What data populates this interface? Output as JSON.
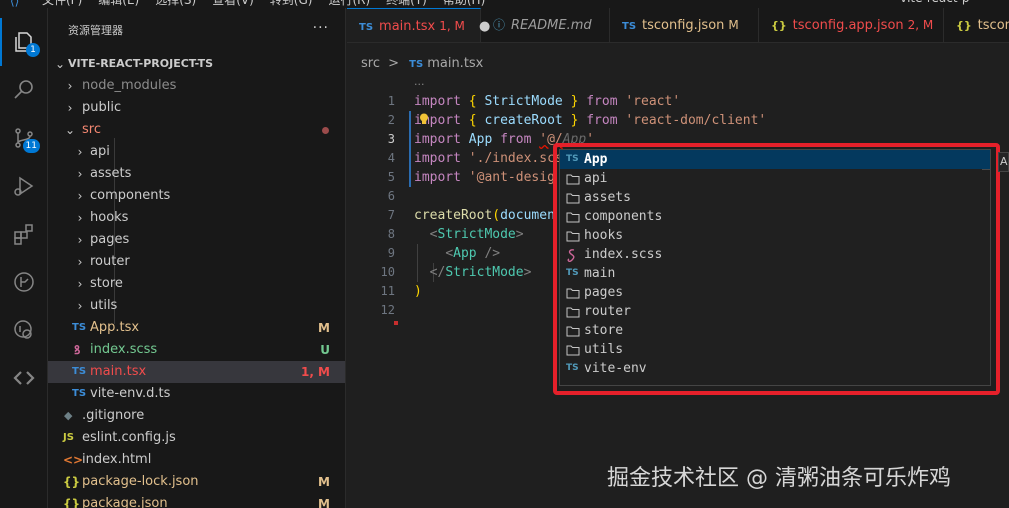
{
  "menubar": {
    "items": [
      "文件(F)",
      "编辑(E)",
      "选择(S)",
      "查看(V)",
      "转到(G)",
      "运行(R)",
      "终端(T)",
      "帮助(H)"
    ],
    "command_center": "vite-react-p"
  },
  "activity_bar": {
    "explorer_badge": "1",
    "scm_badge": "11"
  },
  "sidebar": {
    "title": "资源管理器",
    "more": "···",
    "project": "VITE-REACT-PROJECT-TS",
    "items": {
      "node_modules": "node_modules",
      "public": "public",
      "src": "src",
      "api": "api",
      "assets": "assets",
      "components": "components",
      "hooks": "hooks",
      "pages": "pages",
      "router": "router",
      "store": "store",
      "utils": "utils",
      "app_tsx": "App.tsx",
      "app_status": "M",
      "index_scss": "index.scss",
      "index_scss_status": "U",
      "main_tsx": "main.tsx",
      "main_status": "1, M",
      "vite_env": "vite-env.d.ts",
      "gitignore": ".gitignore",
      "eslint": "eslint.config.js",
      "index_html": "index.html",
      "package_lock": "package-lock.json",
      "package_lock_status": "M",
      "package_json": "package.json",
      "package_json_status": "M"
    }
  },
  "tabs": [
    {
      "label": "main.tsx",
      "status": "1, M",
      "icon": "TS"
    },
    {
      "label": "README.md",
      "status": "",
      "icon": "ⓘ"
    },
    {
      "label": "tsconfig.json",
      "status": "M",
      "icon": "TS"
    },
    {
      "label": "tsconfig.app.json",
      "status": "2, M",
      "icon": "{}"
    },
    {
      "label": "tsconf",
      "status": "",
      "icon": "{}"
    }
  ],
  "breadcrumb": {
    "folder": "src",
    "sep": ">",
    "icon": "TS",
    "file": "main.tsx"
  },
  "editor": {
    "ellipsis": "···",
    "line_numbers": [
      "1",
      "2",
      "3",
      "4",
      "5",
      "6",
      "7",
      "8",
      "9",
      "10",
      "11",
      "12"
    ],
    "code": {
      "l1_import": "import",
      "l1_open": "{",
      "l1_name": "StrictMode",
      "l1_close": "}",
      "l1_from": "from",
      "l1_str": "'react'",
      "l2_import": "import",
      "l2_open": "{",
      "l2_name": "createRoot",
      "l2_close": "}",
      "l2_from": "from",
      "l2_str": "'react-dom/client'",
      "l3_import": "import",
      "l3_name": "App",
      "l3_from": "from",
      "l3_str": "'@/",
      "l3_ghost": "App",
      "l3_end": "'",
      "l4_import": "import",
      "l4_str": "'./index.scs",
      "l5_import": "import",
      "l5_str": "'@ant-desig",
      "l7_fn": "createRoot",
      "l7_paren": "(",
      "l7_arg": "documen",
      "l8_tag": "StrictMode",
      "l9_tag": "App",
      "l10_tag": "StrictMode",
      "l11": ")"
    }
  },
  "suggestions": [
    {
      "label": "App",
      "icon": "ts-file-icon",
      "badge": "TS",
      "selected": true
    },
    {
      "label": "api",
      "icon": "folder-icon",
      "badge": ""
    },
    {
      "label": "assets",
      "icon": "folder-icon",
      "badge": ""
    },
    {
      "label": "components",
      "icon": "folder-icon",
      "badge": ""
    },
    {
      "label": "hooks",
      "icon": "folder-icon",
      "badge": ""
    },
    {
      "label": "index.scss",
      "icon": "sass-file-icon",
      "badge": ""
    },
    {
      "label": "main",
      "icon": "ts-file-icon",
      "badge": "TS"
    },
    {
      "label": "pages",
      "icon": "folder-icon",
      "badge": ""
    },
    {
      "label": "router",
      "icon": "folder-icon",
      "badge": ""
    },
    {
      "label": "store",
      "icon": "folder-icon",
      "badge": ""
    },
    {
      "label": "utils",
      "icon": "folder-icon",
      "badge": ""
    },
    {
      "label": "vite-env",
      "icon": "ts-file-icon",
      "badge": "TS"
    }
  ],
  "edge_hint": "Ap",
  "watermark": "掘金技术社区 @ 清粥油条可乐炸鸡",
  "colors": {
    "accent": "#0078d4",
    "modified": "#e2c08d",
    "untracked": "#73c991",
    "error": "#f14c4c",
    "highlight_box": "#e5202a",
    "ts_blue": "#3c8dd8"
  }
}
